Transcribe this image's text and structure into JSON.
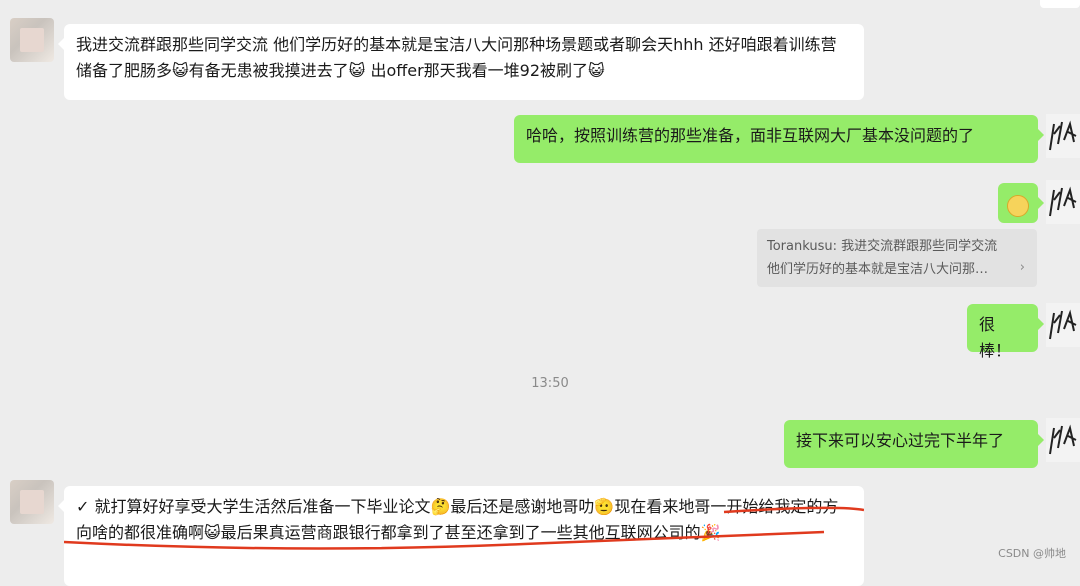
{
  "messages": [
    {
      "side": "left",
      "text": "我进交流群跟那些同学交流 他们学历好的基本就是宝洁八大问那种场景题或者聊会天hhh 还好咱跟着训练营储备了肥肠多😺有备无患被我摸进去了😺 出offer那天我看一堆92被刷了😺"
    },
    {
      "side": "right",
      "text": "哈哈，按照训练营的那些准备，面非互联网大厂基本没问题的了"
    },
    {
      "side": "right",
      "type": "sticker",
      "icon": "smiling-face-emoji"
    },
    {
      "side": "right",
      "type": "quote",
      "quote_lines": [
        "Torankusu: 我进交流群跟那些同学交流",
        "他们学历好的基本就是宝洁八大问那…"
      ],
      "chevron": "›"
    },
    {
      "side": "right",
      "text": "很棒！"
    },
    {
      "type": "time",
      "text": "13:50"
    },
    {
      "side": "right",
      "text": "接下来可以安心过完下半年了"
    },
    {
      "side": "left",
      "text": "✓ 就打算好好享受大学生活然后准备一下毕业论文🤔最后还是感谢地哥叻🫡现在看来地哥一开始给我定的方向啥的都很准确啊😺最后果真运营商跟银行都拿到了甚至还拿到了一些其他互联网公司的🎉"
    }
  ],
  "watermark": "CSDN @帅地",
  "colors": {
    "background": "#ededed",
    "left_bubble": "#ffffff",
    "right_bubble": "#95ec69",
    "highlight_underline": "#e03a1e"
  }
}
